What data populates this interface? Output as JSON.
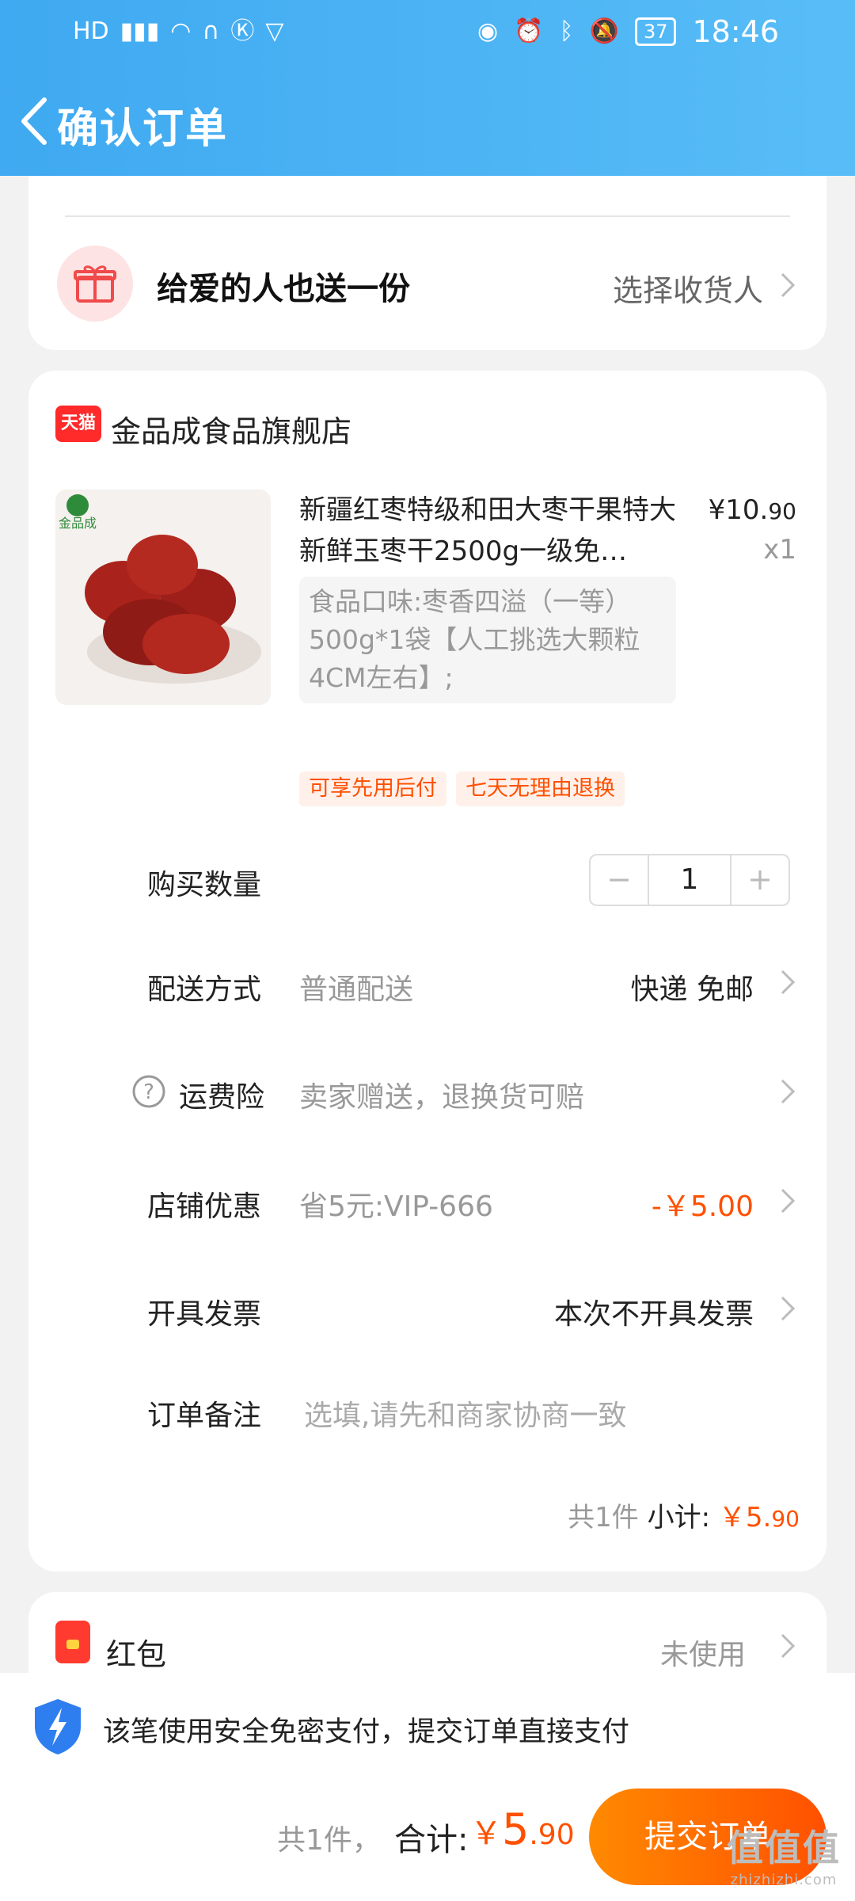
{
  "status_bar": {
    "left_icons": [
      "HD",
      "4G",
      "signal",
      "wifi",
      "headphones",
      "K",
      "shield"
    ],
    "battery": "37",
    "time": "18:46"
  },
  "header": {
    "title": "确认订单"
  },
  "gift": {
    "title": "给爱的人也送一份",
    "action": "选择收货人"
  },
  "store": {
    "badge": "天猫",
    "name": "金品成食品旗舰店"
  },
  "product": {
    "title": "新疆红枣特级和田大枣干果特大新鲜玉枣干2500g一级免…",
    "price_main": "¥10.",
    "price_small": "90",
    "quantity_text": "x1",
    "sku": "食品口味:枣香四溢（一等）500g*1袋【人工挑选大颗粒4CM左右】;",
    "image_brand": "金品成",
    "tags": [
      "可享先用后付",
      "七天无理由退换"
    ]
  },
  "rows": {
    "quantity_label": "购买数量",
    "quantity_value": "1",
    "minus": "−",
    "plus": "+",
    "delivery_label": "配送方式",
    "delivery_sub": "普通配送",
    "delivery_value": "快递 免邮",
    "insurance_label": "运费险",
    "insurance_sub": "卖家赠送，退换货可赔",
    "discount_label": "店铺优惠",
    "discount_sub": "省5元:VIP-666",
    "discount_value": "-￥5.00",
    "invoice_label": "开具发票",
    "invoice_value": "本次不开具发票",
    "note_label": "订单备注",
    "note_placeholder": "选填,请先和商家协商一致"
  },
  "subtotal": {
    "count": "共1件",
    "label": "小计:",
    "amount_main": "￥5.",
    "amount_small": "90"
  },
  "redpacket": {
    "label": "红包",
    "status": "未使用"
  },
  "bottom": {
    "secure_text": "该笔使用安全免密支付，提交订单直接支付",
    "count": "共1件，",
    "total_label": "合计:",
    "currency": "￥",
    "total_big": "5",
    "total_small": ".90",
    "submit_label": "提交订单"
  },
  "watermark": {
    "line1": "值值值",
    "line2": "zhizhizhi.com"
  },
  "colors": {
    "accent": "#ff5000",
    "header": "#3fa9f1",
    "tmall": "#ff2a2a"
  }
}
